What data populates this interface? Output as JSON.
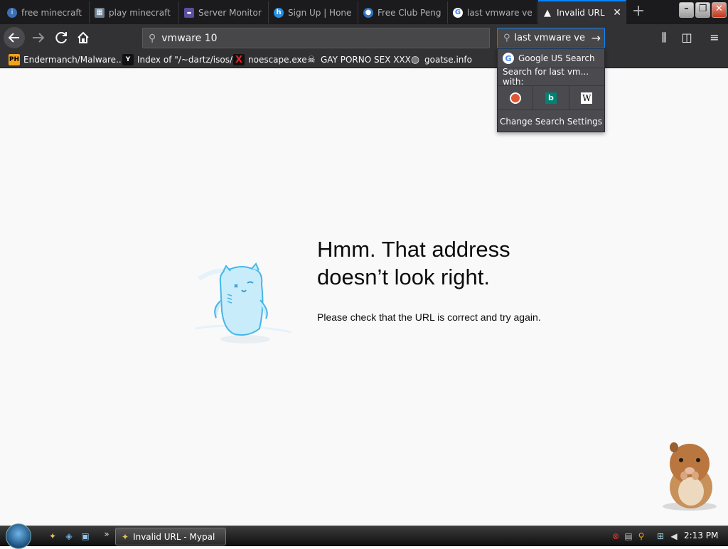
{
  "tabs": [
    {
      "label": "free minecraft",
      "icon": "info-icon",
      "active": false
    },
    {
      "label": "play minecraft",
      "icon": "minecraft-icon",
      "active": false
    },
    {
      "label": "Server Monitor",
      "icon": "server-icon",
      "active": false
    },
    {
      "label": "Sign Up | Hone",
      "icon": "hone-icon",
      "active": false
    },
    {
      "label": "Free Club Peng",
      "icon": "penguin-icon",
      "active": false
    },
    {
      "label": "last vmware ve",
      "icon": "google-icon",
      "active": false
    },
    {
      "label": "Invalid URL",
      "icon": "warning-icon",
      "active": true
    }
  ],
  "new_tab_label": "+",
  "window_controls": {
    "minimize": "–",
    "restore": "❐",
    "close": "✕"
  },
  "url_bar": {
    "value": "vmware 10"
  },
  "search_bar": {
    "value": "last vmware ve"
  },
  "bookmarks": [
    {
      "label": "Endermanch/Malware...",
      "icon": "ph-icon",
      "icon_text": "PH"
    },
    {
      "label": "Index of \"/~dartz/isos/\"",
      "icon": "yc-icon",
      "icon_text": "Y"
    },
    {
      "label": "noescape.exe",
      "icon": "x-icon",
      "icon_text": "X"
    },
    {
      "label": "GAY PORNO SEX XXX",
      "icon": "skull-icon",
      "icon_text": "☠"
    },
    {
      "label": "goatse.info",
      "icon": "globe-icon",
      "icon_text": "◍"
    }
  ],
  "search_dropdown": {
    "google_label": "Google US Search",
    "search_for_label": "Search for last vm... with:",
    "engines": [
      "duckduckgo-icon",
      "bing-icon",
      "wikipedia-icon"
    ],
    "change_settings_label": "Change Search Settings"
  },
  "error_page": {
    "title": "Hmm. That address doesn’t look right.",
    "message": "Please check that the URL is correct and try again."
  },
  "taskbar": {
    "task_label": "Invalid URL - Mypal",
    "chevron": "»",
    "clock": "2:13 PM"
  },
  "colors": {
    "accent": "#0a84ff",
    "toolbar": "#323234",
    "tabstrip": "#1b1b1d",
    "page_bg": "#f9f9fa"
  }
}
